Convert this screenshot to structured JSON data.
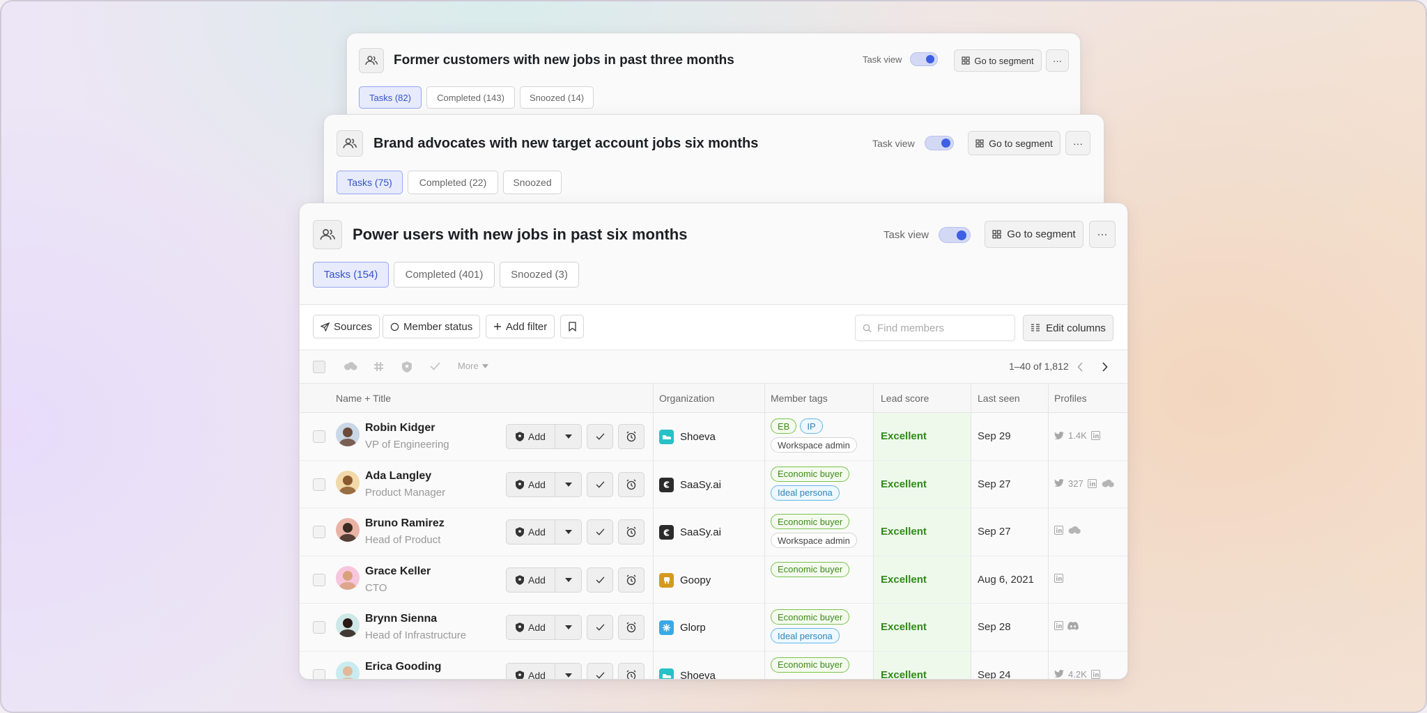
{
  "colors": {
    "accent": "#3d5fe3",
    "lead_excellent": "#2f8a15"
  },
  "cards": [
    {
      "title": "Former customers with new jobs in past three months",
      "task_view_label": "Task view",
      "goto_label": "Go to segment",
      "more_glyph": "···",
      "tabs": [
        "Tasks (82)",
        "Completed (143)",
        "Snoozed (14)"
      ]
    },
    {
      "title": "Brand advocates with new target account jobs six months",
      "task_view_label": "Task view",
      "goto_label": "Go to segment",
      "more_glyph": "···",
      "tabs": [
        "Tasks (75)",
        "Completed (22)",
        "Snoozed"
      ]
    },
    {
      "title": "Power users with new jobs in past six months",
      "task_view_label": "Task view",
      "goto_label": "Go to segment",
      "more_glyph": "···",
      "tabs": [
        "Tasks (154)",
        "Completed (401)",
        "Snoozed (3)"
      ]
    }
  ],
  "toolbar": {
    "sources": "Sources",
    "member_status": "Member status",
    "add_filter": "Add filter",
    "search_placeholder": "Find members",
    "edit_columns": "Edit columns"
  },
  "actions": {
    "more": "More",
    "pagination": "1–40 of 1,812"
  },
  "columns": [
    "Name + Title",
    "Organization",
    "Member tags",
    "Lead score",
    "Last seen",
    "Profiles"
  ],
  "row_add_label": "Add",
  "members": [
    {
      "name": "Robin Kidger",
      "title": "VP of Engineering",
      "org": "Shoeva",
      "org_logo": "shoe-icon",
      "tags": [
        [
          "EB:green",
          "IP:blue"
        ],
        [
          "Workspace admin:gray"
        ]
      ],
      "lead": "Excellent",
      "seen": "Sep 29",
      "profiles": [
        "twitter-icon",
        "linkedin-icon"
      ],
      "followers": "1.4K"
    },
    {
      "name": "Ada Langley",
      "title": "Product Manager",
      "org": "SaaSy.ai",
      "org_logo": "saasy-icon",
      "tags": [
        [
          "Economic buyer:green"
        ],
        [
          "Ideal persona:blue"
        ]
      ],
      "lead": "Excellent",
      "seen": "Sep 27",
      "profiles": [
        "twitter-icon",
        "linkedin-icon",
        "salesforce-icon"
      ],
      "followers": "327"
    },
    {
      "name": "Bruno Ramirez",
      "title": "Head of Product",
      "org": "SaaSy.ai",
      "org_logo": "saasy-icon",
      "tags": [
        [
          "Economic buyer:green"
        ],
        [
          "Workspace admin:gray"
        ]
      ],
      "lead": "Excellent",
      "seen": "Sep 27",
      "profiles": [
        "linkedin-icon",
        "salesforce-icon"
      ],
      "followers": ""
    },
    {
      "name": "Grace Keller",
      "title": "CTO",
      "org": "Goopy",
      "org_logo": "goopy-icon",
      "tags": [
        [
          "Economic buyer:green"
        ]
      ],
      "lead": "Excellent",
      "seen": "Aug 6, 2021",
      "profiles": [
        "linkedin-icon"
      ],
      "followers": ""
    },
    {
      "name": "Brynn Sienna",
      "title": "Head of Infrastructure",
      "org": "Glorp",
      "org_logo": "glorp-icon",
      "tags": [
        [
          "Economic buyer:green"
        ],
        [
          "Ideal persona:blue"
        ]
      ],
      "lead": "Excellent",
      "seen": "Sep 28",
      "profiles": [
        "linkedin-icon",
        "discord-icon"
      ],
      "followers": ""
    },
    {
      "name": "Erica Gooding",
      "title": "",
      "org": "Shoeva",
      "org_logo": "shoe-icon",
      "tags": [
        [
          "Economic buyer:green"
        ]
      ],
      "lead": "Excellent",
      "seen": "Sep 24",
      "profiles": [
        "twitter-icon",
        "linkedin-icon"
      ],
      "followers": "4.2K"
    }
  ]
}
